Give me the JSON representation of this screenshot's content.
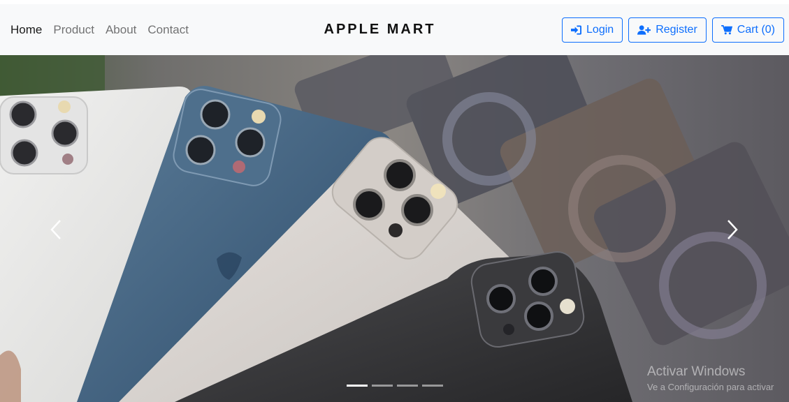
{
  "nav": {
    "links": [
      {
        "label": "Home"
      },
      {
        "label": "Product"
      },
      {
        "label": "About"
      },
      {
        "label": "Contact"
      }
    ],
    "active": "Home",
    "brand": "APPLE MART",
    "buttons": {
      "login": {
        "label": "Login",
        "icon": "sign-in-icon"
      },
      "register": {
        "label": "Register",
        "icon": "user-plus-icon"
      },
      "cart": {
        "label": "Cart (0)",
        "icon": "cart-icon"
      }
    }
  },
  "carousel": {
    "image": "iPhone 12 Pro phones fanned out in front of phone boxes",
    "slide_count": 4,
    "active_slide": 1
  },
  "watermark": {
    "title": "Activar Windows",
    "subtitle": "Ve a Configuración para activar"
  },
  "colors": {
    "accent": "#0d6efd",
    "navbar_bg": "#f8f9fa"
  }
}
